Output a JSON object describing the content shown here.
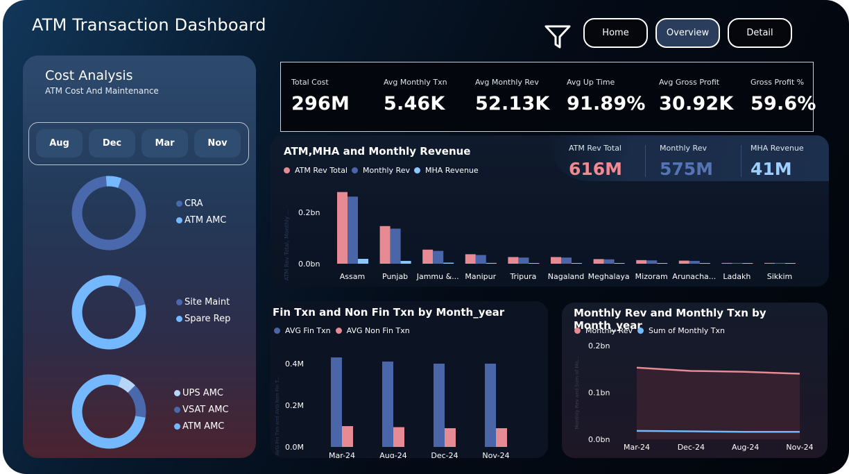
{
  "app": {
    "title": "ATM Transaction Dashboard"
  },
  "nav": {
    "home": "Home",
    "overview": "Overview",
    "detail": "Detail"
  },
  "cost_analysis": {
    "title": "Cost Analysis",
    "subtitle": "ATM Cost And Maintenance",
    "months": [
      "Aug",
      "Dec",
      "Mar",
      "Nov"
    ],
    "donuts": [
      {
        "segments": [
          {
            "label": "CRA",
            "color": "#4a69ad",
            "value": 0.93
          },
          {
            "label": "ATM AMC",
            "color": "#74b9ff",
            "value": 0.07
          }
        ]
      },
      {
        "segments": [
          {
            "label": "Site Maint",
            "color": "#4a69ad",
            "value": 0.16
          },
          {
            "label": "Spare Rep",
            "color": "#74b9ff",
            "value": 0.84
          }
        ]
      },
      {
        "segments": [
          {
            "label": "UPS AMC",
            "color": "#b6d6f7",
            "value": 0.07
          },
          {
            "label": "VSAT AMC",
            "color": "#4a69ad",
            "value": 0.15
          },
          {
            "label": "ATM AMC",
            "color": "#74b9ff",
            "value": 0.78
          }
        ]
      }
    ]
  },
  "kpis": [
    {
      "label": "Total Cost",
      "value": "296M"
    },
    {
      "label": "Avg Monthly Txn",
      "value": "5.46K"
    },
    {
      "label": "Avg Monthly Rev",
      "value": "52.13K"
    },
    {
      "label": "Avg Up Time",
      "value": "91.89%"
    },
    {
      "label": "Avg Gross Profit",
      "value": "30.92K"
    },
    {
      "label": "Gross Profit %",
      "value": "59.6%"
    }
  ],
  "revenue": {
    "cards": [
      {
        "label": "ATM Rev Total",
        "value": "616M",
        "color": "#f08a92"
      },
      {
        "label": "Monthly Rev",
        "value": "575M",
        "color": "#5574b5"
      },
      {
        "label": "MHA Revenue",
        "value": "41M",
        "color": "#9ccfff"
      }
    ]
  },
  "chart_data": [
    {
      "type": "bar",
      "title": "ATM,MHA and Monthly Revenue",
      "ylabel": "ATM Rev Total, Monthly ...",
      "categories": [
        "Assam",
        "Punjab",
        "Jammu &...",
        "Manipur",
        "Tripura",
        "Nagaland",
        "Meghalaya",
        "Mizoram",
        "Arunacha...",
        "Ladakh",
        "Sikkim"
      ],
      "yticks": [
        "0.0bn",
        "0.2bn"
      ],
      "ylim": [
        0,
        0.29
      ],
      "series": [
        {
          "name": "ATM Rev Total",
          "color": "#e68a94",
          "values": [
            0.28,
            0.147,
            0.055,
            0.037,
            0.026,
            0.026,
            0.018,
            0.014,
            0.012,
            0.003,
            0.003
          ]
        },
        {
          "name": "Monthly Rev",
          "color": "#4a66a8",
          "values": [
            0.262,
            0.137,
            0.05,
            0.034,
            0.024,
            0.024,
            0.017,
            0.013,
            0.011,
            0.003,
            0.003
          ]
        },
        {
          "name": "MHA Revenue",
          "color": "#8cc8ff",
          "values": [
            0.019,
            0.011,
            0.004,
            0.003,
            0.002,
            0.002,
            0.001,
            0.001,
            0.001,
            0.0,
            0.0
          ]
        }
      ]
    },
    {
      "type": "bar",
      "title": "Fin Txn and Non Fin Txn by Month_year",
      "ylabel": "AVG Fin Txn and AVG Non Fin T...",
      "categories": [
        "Mar-24",
        "Aug-24",
        "Dec-24",
        "Nov-24"
      ],
      "yticks": [
        "0.0M",
        "0.2M",
        "0.4M"
      ],
      "ylim": [
        0,
        0.5
      ],
      "series": [
        {
          "name": "AVG Fin Txn",
          "color": "#4a66a8",
          "values": [
            0.43,
            0.41,
            0.4,
            0.4
          ]
        },
        {
          "name": "AVG Non Fin Txn",
          "color": "#e68a94",
          "values": [
            0.1,
            0.095,
            0.09,
            0.09
          ]
        }
      ]
    },
    {
      "type": "area",
      "title": "Monthly Rev and Monthly Txn by Month_year",
      "ylabel": "Monthly Rev and Sum of Mo...",
      "x": [
        "Mar-24",
        "Dec-24",
        "Aug-24",
        "Nov-24"
      ],
      "yticks": [
        "0.0bn",
        "0.1bn",
        "0.2bn"
      ],
      "ylim": [
        0,
        0.2
      ],
      "series": [
        {
          "name": "Monthly Rev",
          "color": "#e68a94",
          "values": [
            0.153,
            0.146,
            0.144,
            0.14
          ]
        },
        {
          "name": "Sum of Monthly Txn",
          "color": "#74b9ff",
          "values": [
            0.018,
            0.017,
            0.016,
            0.016
          ]
        }
      ]
    }
  ]
}
